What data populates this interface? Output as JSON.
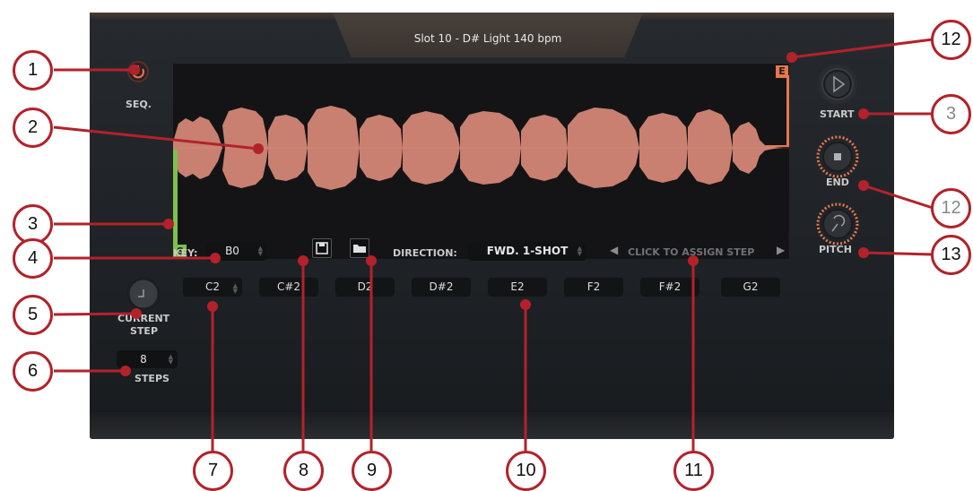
{
  "slot": {
    "title": "Slot 10 - D# Light 140 bpm"
  },
  "seq": {
    "label": "SEQ."
  },
  "markers": {
    "start": "S",
    "end": "E"
  },
  "knobs": {
    "start": "START",
    "end": "END",
    "pitch": "PITCH",
    "current_step_line1": "CURRENT",
    "current_step_line2": "STEP"
  },
  "key": {
    "label": "KEY:",
    "value": "B0"
  },
  "direction": {
    "label": "DIRECTION:",
    "value": "FWD. 1-SHOT"
  },
  "assign": {
    "text": "CLICK TO ASSIGN STEP"
  },
  "steps": {
    "value": "8",
    "label": "STEPS"
  },
  "notes": [
    "C2",
    "C#2",
    "D2",
    "D#2",
    "E2",
    "F2",
    "F#2",
    "G2"
  ],
  "callouts": {
    "c1": "1",
    "c2": "2",
    "c3a": "3",
    "c4": "4",
    "c5": "5",
    "c6": "6",
    "c7": "7",
    "c8": "8",
    "c9": "9",
    "c10": "10",
    "c11": "11",
    "c12a": "12",
    "c3b": "3",
    "c12b": "12",
    "c13": "13"
  },
  "colors": {
    "accent": "#e8774a",
    "waveform": "#d98a78",
    "start_marker": "#7ec04c",
    "callout": "#b3222a"
  }
}
